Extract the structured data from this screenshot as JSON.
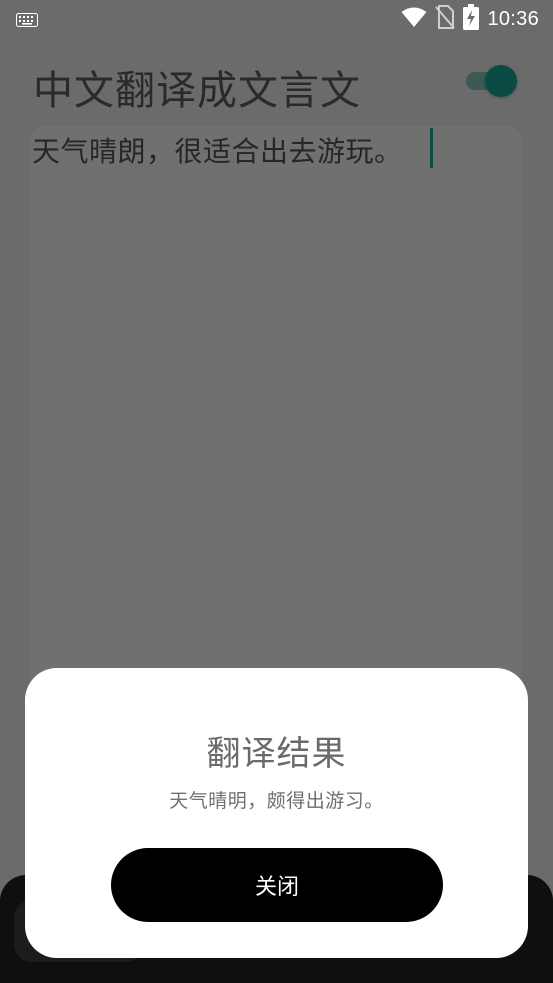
{
  "status_bar": {
    "time": "10:36",
    "icons": [
      "keyboard-icon",
      "wifi-icon",
      "no-sim-icon",
      "battery-charging-icon"
    ]
  },
  "app": {
    "title": "中文翻译成文言文",
    "toggle_on": true,
    "accent_color": "#0b4a42"
  },
  "input": {
    "value": "天气晴朗，很适合出去游玩。"
  },
  "dialog": {
    "title": "翻译结果",
    "message": "天气晴明，颇得出游习。",
    "close_label": "关闭"
  }
}
